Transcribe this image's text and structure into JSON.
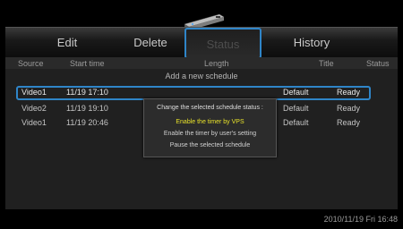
{
  "tabs": {
    "edit": "Edit",
    "delete": "Delete",
    "status": "Status",
    "history": "History"
  },
  "table": {
    "headers": {
      "source": "Source",
      "start_time": "Start time",
      "length": "Length",
      "title": "Title",
      "status": "Status"
    },
    "add_new": "Add a new schedule",
    "rows": [
      {
        "source": "Video1",
        "start_time": "11/19 17:10",
        "length": "",
        "title": "Default",
        "status": "Ready"
      },
      {
        "source": "Video2",
        "start_time": "11/19 19:10",
        "length": "",
        "title": "Default",
        "status": "Ready"
      },
      {
        "source": "Video1",
        "start_time": "11/19 20:46",
        "length": "",
        "title": "Default",
        "status": "Ready"
      }
    ]
  },
  "popup": {
    "title": "Change the selected schedule status :",
    "options": [
      "Enable the timer by VPS",
      "Enable the timer by user's setting",
      "Pause the selected schedule"
    ]
  },
  "footer": {
    "datetime": "2010/11/19 Fri 16:48"
  },
  "colors": {
    "accent": "#2f85c8",
    "highlight": "#e8e22a"
  }
}
